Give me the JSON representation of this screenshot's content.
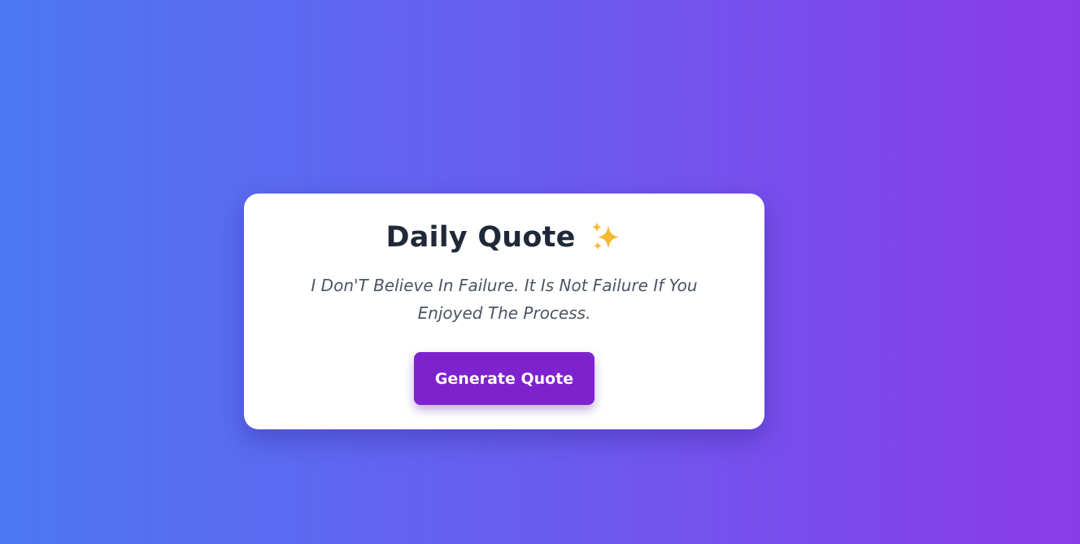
{
  "card": {
    "title": "Daily Quote",
    "title_icon": "sparkles-icon",
    "quote": "I Don'T Believe In Failure. It Is Not Failure If You Enjoyed The Process.",
    "button_label": "Generate Quote"
  },
  "colors": {
    "background_start": "#4c78f3",
    "background_end": "#8a3be9",
    "card_bg": "#ffffff",
    "title": "#1f2937",
    "quote": "#4b5563",
    "button_bg": "#7e22ce",
    "button_text": "#ffffff",
    "sparkle": "#f5b82e"
  }
}
